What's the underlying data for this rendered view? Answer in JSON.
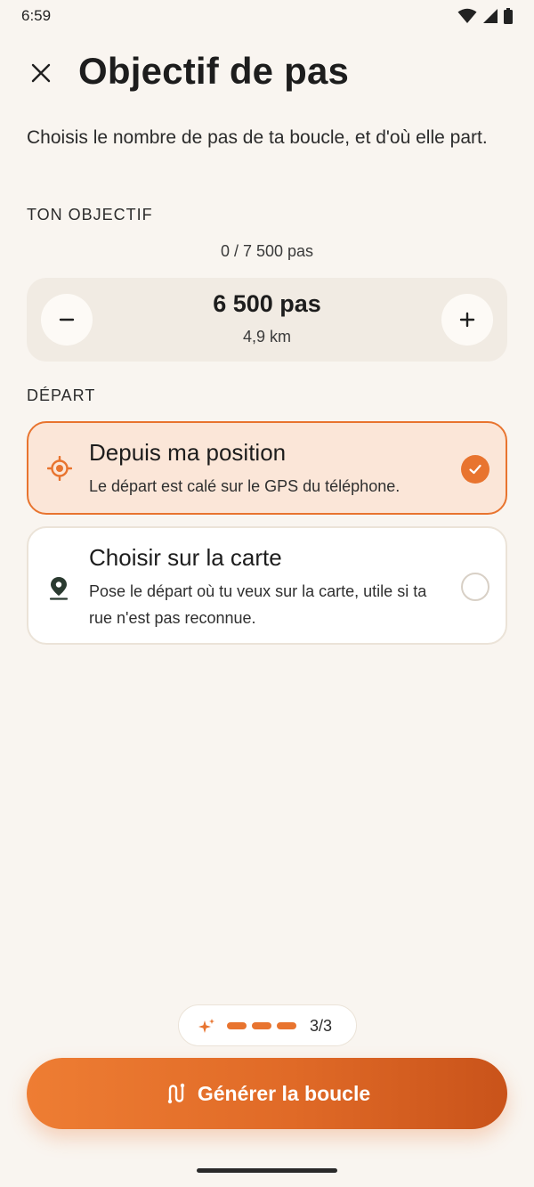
{
  "status_bar": {
    "time": "6:59"
  },
  "header": {
    "title": "Objectif de pas"
  },
  "intro": {
    "text": "Choisis le nombre de pas de ta boucle, et d'où elle part."
  },
  "goal": {
    "section_label": "TON OBJECTIF",
    "progress": "0 / 7 500 pas",
    "value": "6 500 pas",
    "distance": "4,9 km"
  },
  "departure": {
    "section_label": "DÉPART",
    "options": [
      {
        "title": "Depuis ma position",
        "description": "Le départ est calé sur le GPS du téléphone.",
        "selected": true,
        "icon": "gps-target-icon"
      },
      {
        "title": "Choisir sur la carte",
        "description": "Pose le départ où tu veux sur la carte, utile si ta rue n'est pas reconnue.",
        "selected": false,
        "icon": "map-pin-icon"
      }
    ]
  },
  "steps_indicator": {
    "count": "3/3",
    "current": 3,
    "total": 3
  },
  "cta": {
    "label": "Générer la boucle",
    "icon": "route-icon"
  },
  "colors": {
    "accent": "#e8742f",
    "background": "#f9f5f0",
    "selected_card": "#fbe6d8"
  }
}
